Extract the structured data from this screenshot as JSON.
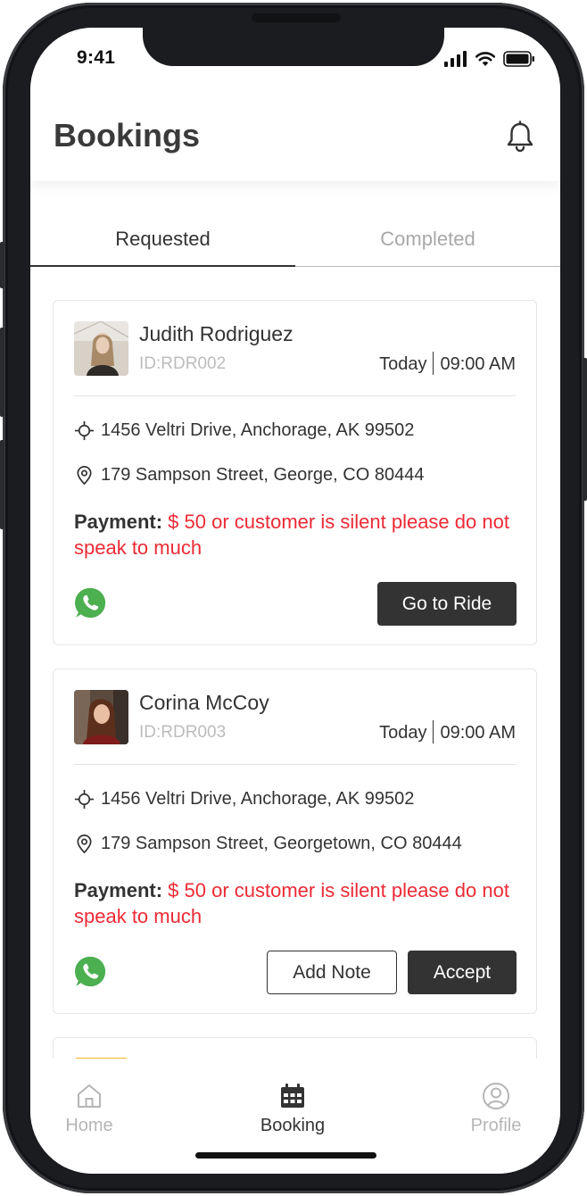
{
  "status_bar": {
    "time": "9:41"
  },
  "header": {
    "title": "Bookings"
  },
  "tabs": [
    {
      "label": "Requested",
      "active": true
    },
    {
      "label": "Completed",
      "active": false
    }
  ],
  "bookings": [
    {
      "name": "Judith Rodriguez",
      "id": "ID:RDR002",
      "day": "Today",
      "time": "09:00 AM",
      "pickup": "1456 Veltri Drive, Anchorage, AK 99502",
      "dropoff": "179 Sampson Street, George, CO 80444",
      "payment_label": "Payment:",
      "payment_value": "$ 50 or customer is silent please do not speak to much",
      "primary_button": "Go to Ride"
    },
    {
      "name": "Corina McCoy",
      "id": "ID:RDR003",
      "day": "Today",
      "time": "09:00 AM",
      "pickup": "1456 Veltri Drive, Anchorage, AK 99502",
      "dropoff": "179 Sampson Street, Georgetown, CO 80444",
      "payment_label": "Payment:",
      "payment_value": "$ 50 or customer is silent please do not speak to much",
      "secondary_button": "Add Note",
      "primary_button": "Accept"
    }
  ],
  "bottom_nav": [
    {
      "label": "Home",
      "icon": "home-icon",
      "active": false
    },
    {
      "label": "Booking",
      "icon": "calendar-icon",
      "active": true
    },
    {
      "label": "Profile",
      "icon": "user-circle-icon",
      "active": false
    }
  ],
  "colors": {
    "accent_dark": "#333333",
    "payment_red": "#ec2a36",
    "whatsapp_green": "#4caf50",
    "inactive_gray": "#b5b5b5"
  }
}
